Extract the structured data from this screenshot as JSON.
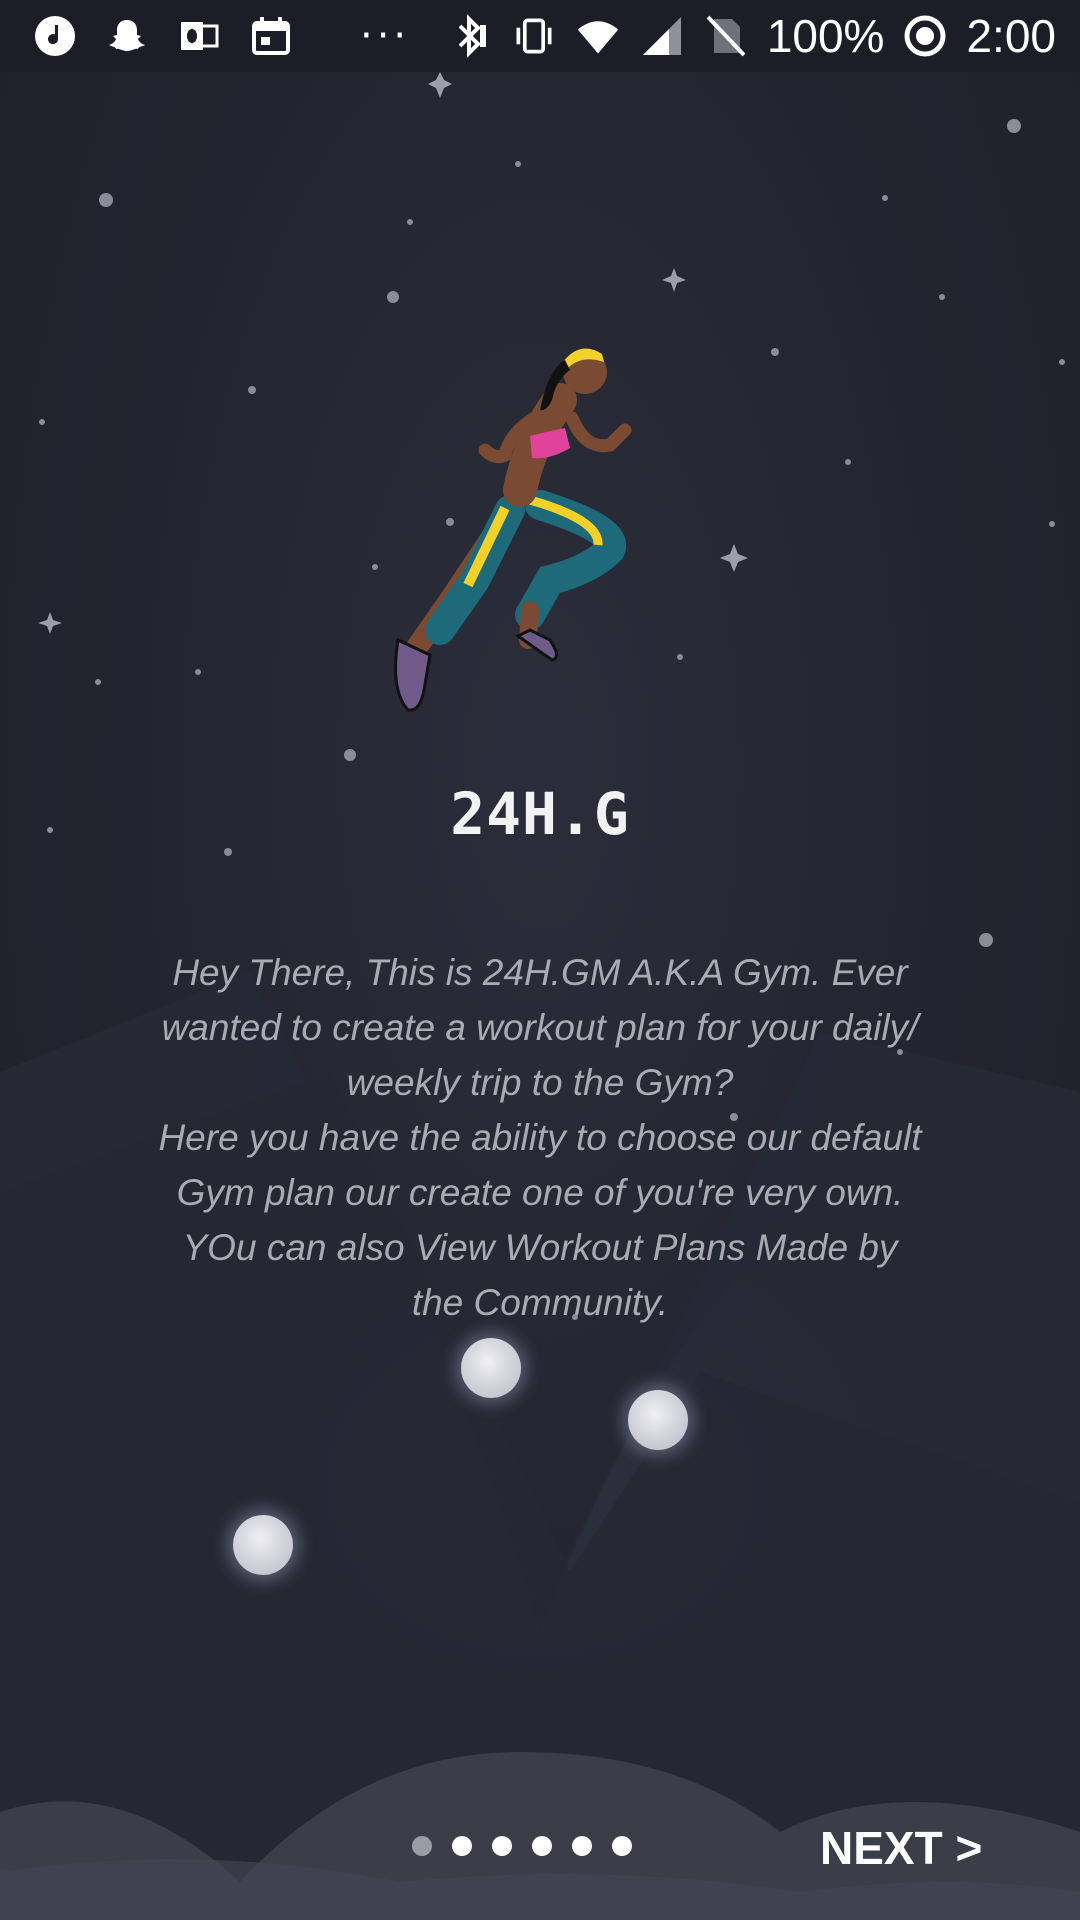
{
  "status_bar": {
    "battery_text": "100%",
    "time": "2:00",
    "more_indicator": "···",
    "icons": [
      "music-note-icon",
      "snapchat-icon",
      "outlook-icon",
      "calendar-icon",
      "bluetooth-icon",
      "vibrate-icon",
      "wifi-icon",
      "signal-icon",
      "no-sim-icon",
      "battery-saver-icon"
    ]
  },
  "onboarding": {
    "title": "24H.G",
    "description": "Hey There, This is 24H.GM A.K.A Gym. Ever\nwanted to create a workout plan for your daily/\nweekly trip to the Gym?\nHere you have the ability to choose our default\nGym plan our create one of you're very own.\nYOu can also View Workout Plans Made by\nthe Community.",
    "page_count": 6,
    "current_page": 1,
    "next_label": "NEXT >"
  },
  "colors": {
    "background": "#23242f",
    "status_bar": "#1c1d26",
    "title": "#f2f2f2",
    "description": "#a9aab3",
    "pager_active": "#9a9ba5",
    "pager_inactive": "#ffffff"
  }
}
